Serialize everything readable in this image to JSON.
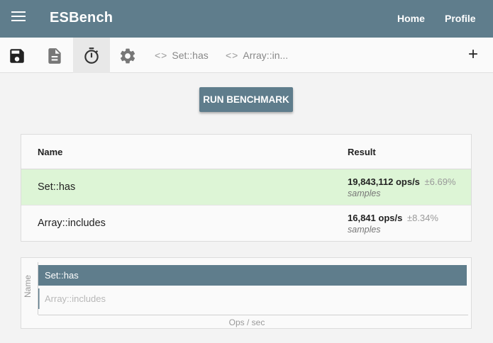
{
  "app": {
    "title": "ESBench",
    "nav": {
      "home": "Home",
      "profile": "Profile"
    }
  },
  "toolbar": {
    "icons": [
      "save-icon",
      "document-icon",
      "stopwatch-icon",
      "gear-icon"
    ],
    "active_tool": "stopwatch-icon",
    "tabs": [
      {
        "label": "Set::has"
      },
      {
        "label": "Array::in..."
      }
    ],
    "add_label": "+"
  },
  "run_button": {
    "label": "RUN BENCHMARK"
  },
  "results": {
    "headers": {
      "name": "Name",
      "result": "Result"
    },
    "rows": [
      {
        "name": "Set::has",
        "ops": "19,843,112 ops/s",
        "rme": "±6.69%",
        "samples": "samples",
        "fastest": true
      },
      {
        "name": "Array::includes",
        "ops": "16,841 ops/s",
        "rme": "±8.34%",
        "samples": "samples",
        "fastest": false
      }
    ]
  },
  "colors": {
    "primary": "#5f7d8c",
    "fastest_row": "#ddf5d6"
  },
  "chart_data": {
    "type": "bar",
    "orientation": "horizontal",
    "categories": [
      "Set::has",
      "Array::includes"
    ],
    "values": [
      19843112,
      16841
    ],
    "xlabel": "Ops / sec",
    "ylabel": "Name"
  }
}
